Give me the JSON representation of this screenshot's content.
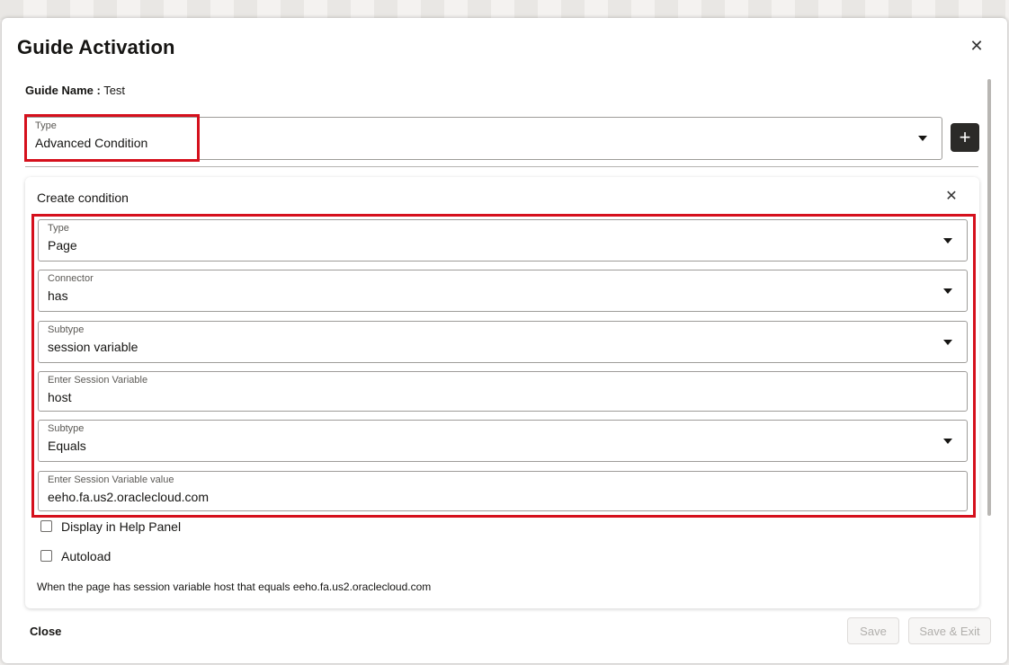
{
  "dialog": {
    "title": "Guide Activation",
    "guide_name_label": "Guide Name :",
    "guide_name_value": "Test"
  },
  "activation": {
    "type_label": "Type",
    "type_value": "Advanced Condition"
  },
  "condition": {
    "title": "Create condition",
    "fields": [
      {
        "label": "Type",
        "value": "Page",
        "kind": "select"
      },
      {
        "label": "Connector",
        "value": "has",
        "kind": "select"
      },
      {
        "label": "Subtype",
        "value": "session variable",
        "kind": "select"
      },
      {
        "label": "Enter Session Variable",
        "value": "host",
        "kind": "input"
      },
      {
        "label": "Subtype",
        "value": "Equals",
        "kind": "select"
      },
      {
        "label": "Enter Session Variable value",
        "value": "eeho.fa.us2.oraclecloud.com",
        "kind": "input"
      }
    ],
    "checkboxes": [
      {
        "label": "Display in Help Panel",
        "checked": false
      },
      {
        "label": "Autoload",
        "checked": false
      }
    ],
    "summary": "When the page has session variable host that equals eeho.fa.us2.oraclecloud.com"
  },
  "footer": {
    "close_label": "Close",
    "save_label": "Save",
    "save_exit_label": "Save & Exit"
  },
  "icons": {
    "close": "close-icon",
    "add": "plus-icon",
    "dropdown": "chevron-down-icon"
  },
  "colors": {
    "highlight": "#d5101c",
    "add_button": "#2b2a28"
  }
}
